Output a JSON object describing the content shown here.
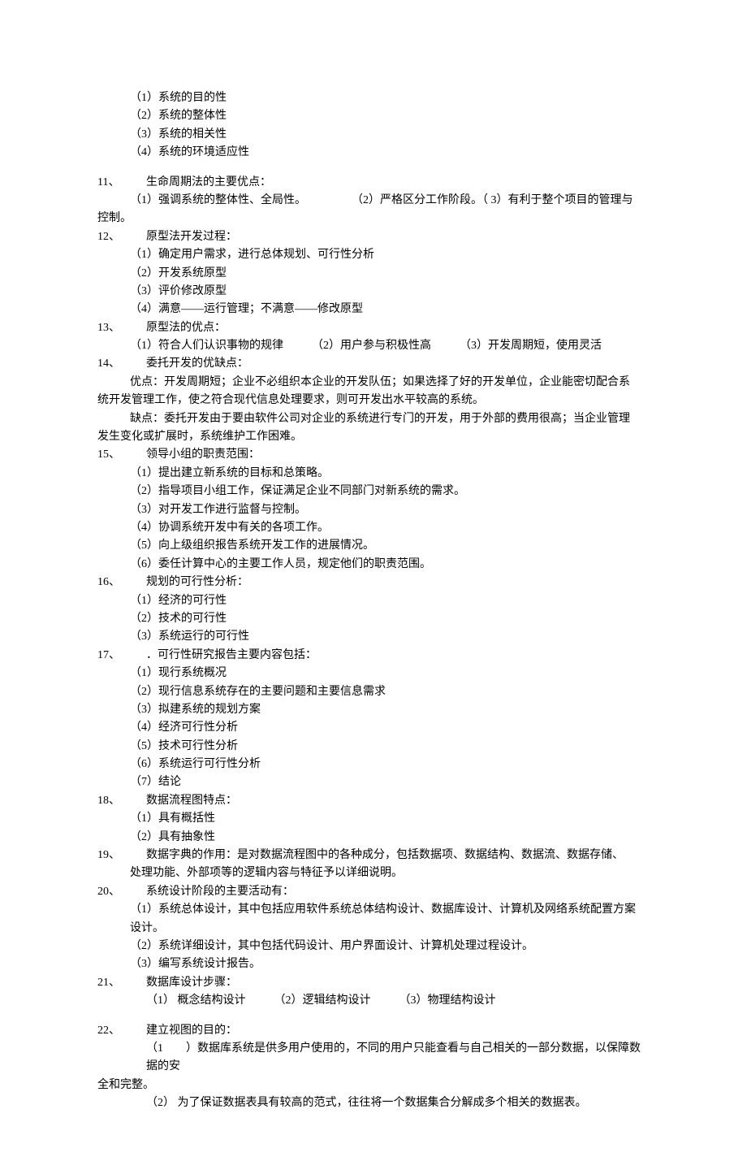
{
  "footer": [
    "（1）系统的目的性",
    "（2）系统的整体性",
    "（3）系统的相关性",
    "（4）系统的环境适应性"
  ],
  "items": [
    {
      "num": "11、",
      "title": "生命周期法的主要优点：",
      "subs": [
        "（1）强调系统的整体性、全局性。　　　　　（2）严格区分工作阶段。（ 3）有利于整个项目的管理与"
      ],
      "cont": "控制。"
    },
    {
      "num": "12、",
      "title": "原型法开发过程：",
      "subs": [
        "（1）确定用户需求，进行总体规划、可行性分析",
        "（2）开发系统原型",
        "（3）评价修改原型",
        "（4）满意——运行管理；不满意——修改原型"
      ]
    },
    {
      "num": "13、",
      "title": "原型法的优点：",
      "subs": [
        "（1）符合人们认识事物的规律　　　（2）用户参与积极性高　　　（3）开发周期短，使用灵活"
      ]
    },
    {
      "num": "14、",
      "title": "委托开发的优缺点：",
      "paras": [
        "优点：开发周期短；企业不必组织本企业的开发队伍；如果选择了好的开发单位，企业能密切配合系",
        "缺点：委托开发由于要由软件公司对企业的系统进行专门的开发，用于外部的费用很高；当企业管理"
      ],
      "paracont": [
        "统开发管理工作，使之符合现代信息处理要求，则可开发出水平较高的系统。",
        "发生变化或扩展时，系统维护工作困难。"
      ]
    },
    {
      "num": "15、",
      "title": "领导小组的职责范围：",
      "subs": [
        "（1）提出建立新系统的目标和总策略。",
        "（2）指导项目小组工作，保证满足企业不同部门对新系统的需求。",
        "（3）对开发工作进行监督与控制。",
        "（4）协调系统开发中有关的各项工作。",
        "（5）向上级组织报告系统开发工作的进展情况。",
        "（6）委任计算中心的主要工作人员，规定他们的职责范围。"
      ]
    },
    {
      "num": "16、",
      "title": "规划的可行性分析：",
      "subs": [
        "（1）经济的可行性",
        "（2）技术的可行性",
        "（3）系统运行的可行性"
      ]
    },
    {
      "num": "17、",
      "title": "．可行性研究报告主要内容包括：",
      "subs": [
        "（1）现行系统概况",
        "（2）现行信息系统存在的主要问题和主要信息需求",
        "（3）拟建系统的规划方案",
        "（4）经济可行性分析",
        "（5）技术可行性分析",
        "（6）系统运行可行性分析",
        "（7）结论"
      ]
    },
    {
      "num": "18、",
      "title": "数据流程图特点：",
      "subs": [
        "（1）具有概括性",
        "（2）具有抽象性"
      ]
    },
    {
      "num": "19、",
      "title": "数据字典的作用：是对数据流程图中的各种成分，包括数据项、数据结构、数据流、数据存储、",
      "subs": [
        "处理功能、外部项等的逻辑内容与特征予以详细说明。"
      ]
    },
    {
      "num": "20、",
      "title": "系统设计阶段的主要活动有：",
      "subs": [
        "（1）系统总体设计，其中包括应用软件系统总体结构设计、数据库设计、计算机及网络系统配置方案 设计。",
        "（2）系统详细设计，其中包括代码设计、用户界面设计、计算机处理过程设计。",
        "（3）编写系统设计报告。"
      ]
    },
    {
      "num": "21、",
      "title": "数据库设计步骤：",
      "subs": [
        "（1）  概念结构设计　　　（2）逻辑结构设计　　　（3）物理结构设计"
      ]
    },
    {
      "num": "22、",
      "title": "建立视图的目的：",
      "subs": [
        "（1　　）数据库系统是供多用户使用的，不同的用户只能查看与自己相关的一部分数据，以保障数据的安"
      ],
      "cont": "全和完整。",
      "subs2": [
        "（2） 为了保证数据表具有较高的范式，往往将一个数据集合分解成多个相关的数据表。"
      ]
    }
  ]
}
